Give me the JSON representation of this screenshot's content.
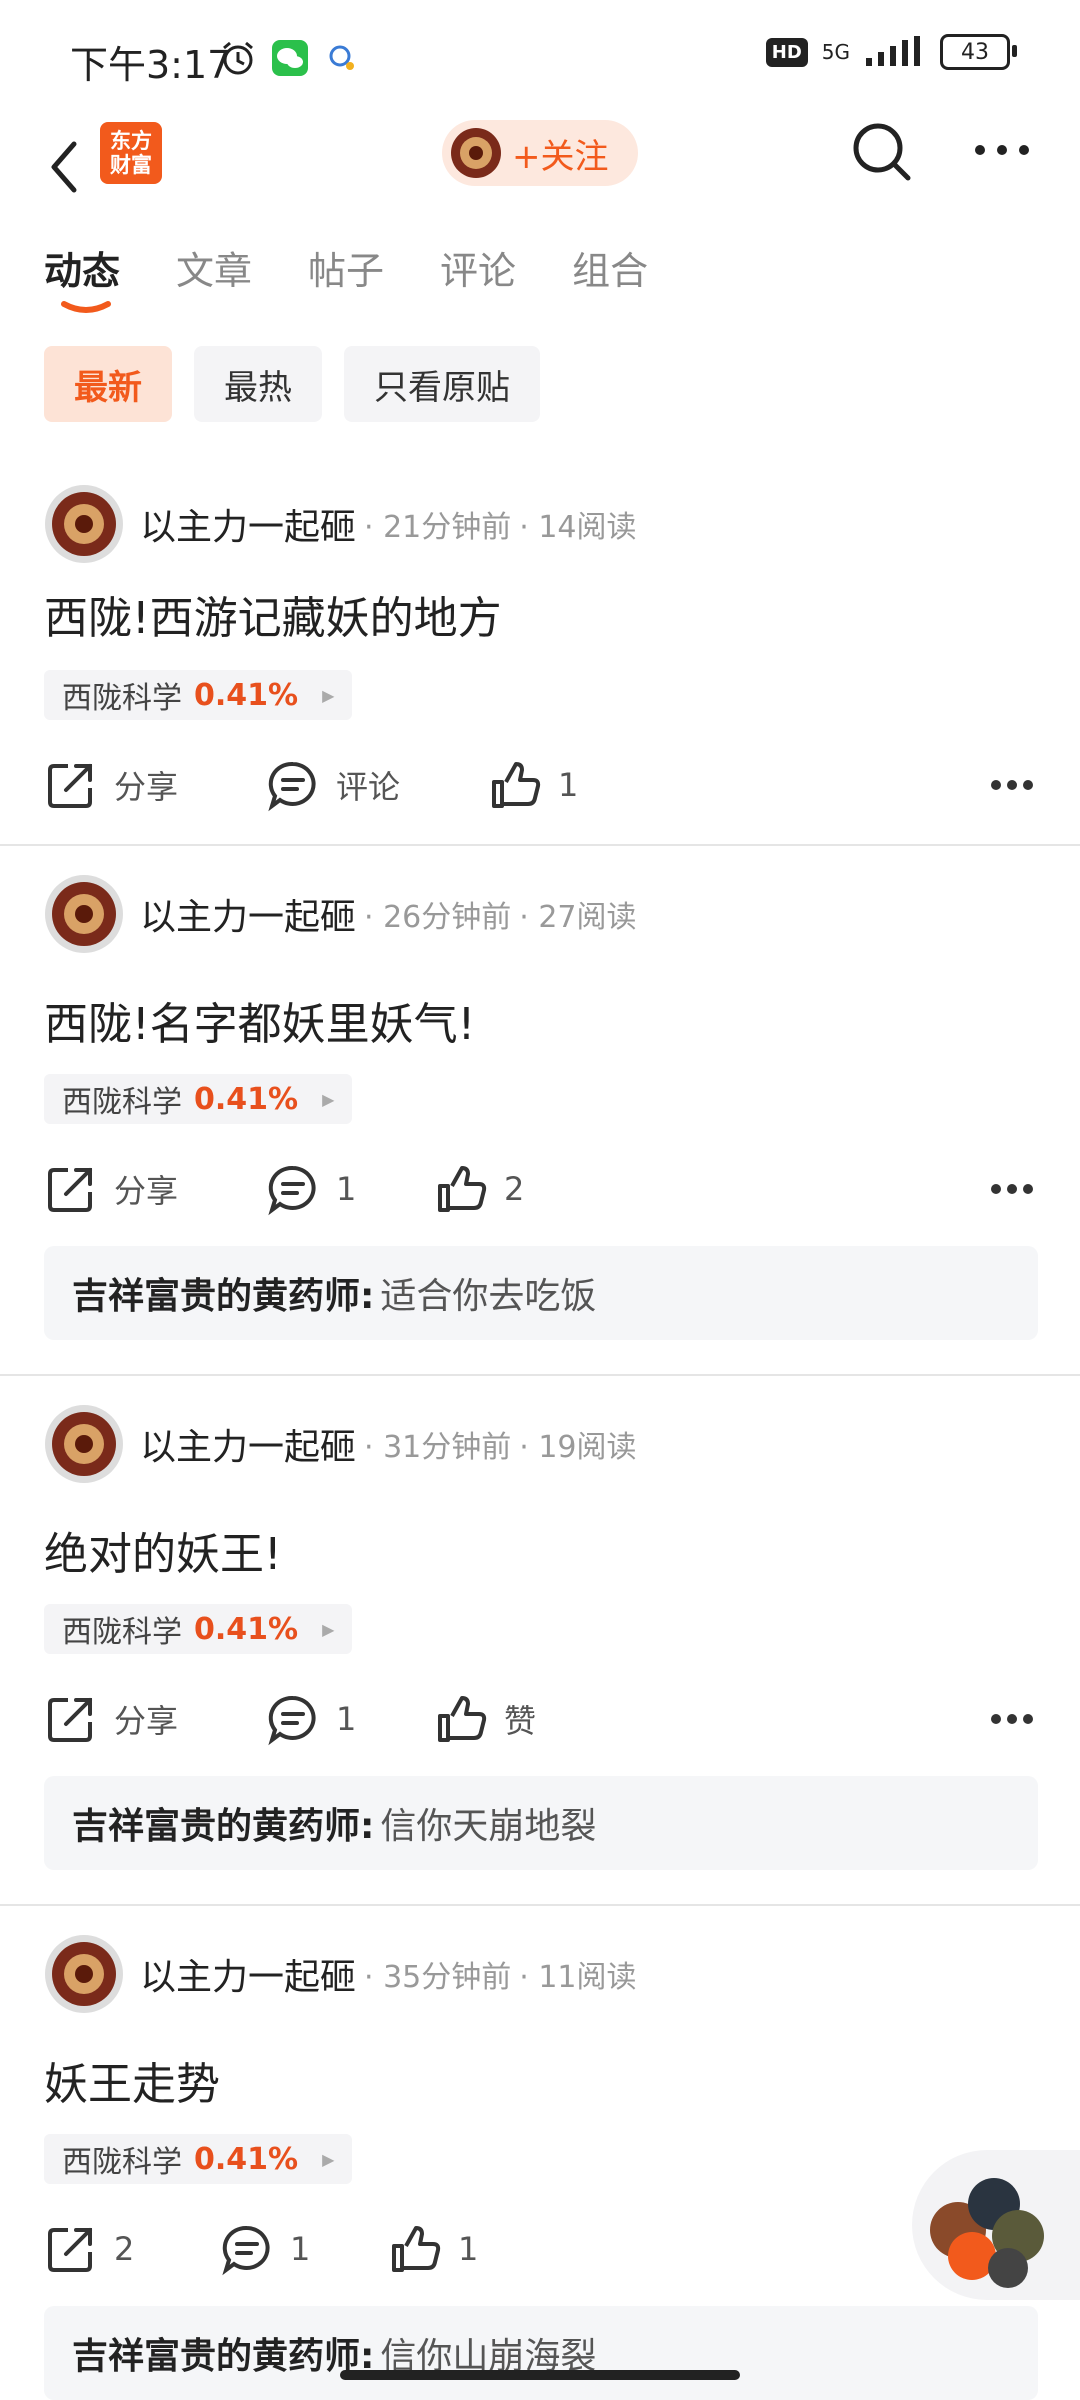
{
  "status_bar": {
    "time": "下午3:17",
    "network": "5G",
    "hd": "HD",
    "battery": "43"
  },
  "navbar": {
    "logo_line1": "东方",
    "logo_line2": "财富",
    "follow_label": "+关注"
  },
  "tabs": [
    {
      "label": "动态"
    },
    {
      "label": "文章"
    },
    {
      "label": "帖子"
    },
    {
      "label": "评论"
    },
    {
      "label": "组合"
    }
  ],
  "filters": [
    {
      "label": "最新"
    },
    {
      "label": "最热"
    },
    {
      "label": "只看原贴"
    }
  ],
  "posts": [
    {
      "author": "以主力一起砸",
      "time": "· 21分钟前",
      "reads": "· 14阅读",
      "title": "西陇!西游记藏妖的地方",
      "stock_name": "西陇科学",
      "stock_pct": "0.41%",
      "share": "分享",
      "comment": "评论",
      "like": "1"
    },
    {
      "author": "以主力一起砸",
      "time": "· 26分钟前",
      "reads": "· 27阅读",
      "title": "西陇!名字都妖里妖气!",
      "stock_name": "西陇科学",
      "stock_pct": "0.41%",
      "share": "分享",
      "comment": "1",
      "like": "2",
      "reply_user": "吉祥富贵的黄药师:",
      "reply_text": "适合你去吃饭"
    },
    {
      "author": "以主力一起砸",
      "time": "· 31分钟前",
      "reads": "· 19阅读",
      "title": "绝对的妖王!",
      "stock_name": "西陇科学",
      "stock_pct": "0.41%",
      "share": "分享",
      "comment": "1",
      "like": "赞",
      "reply_user": "吉祥富贵的黄药师:",
      "reply_text": "信你天崩地裂"
    },
    {
      "author": "以主力一起砸",
      "time": "· 35分钟前",
      "reads": "· 11阅读",
      "title": "妖王走势",
      "stock_name": "西陇科学",
      "stock_pct": "0.41%",
      "share": "2",
      "comment": "1",
      "like": "1",
      "reply_user": "吉祥富贵的黄药师:",
      "reply_text": "信你山崩海裂"
    }
  ]
}
